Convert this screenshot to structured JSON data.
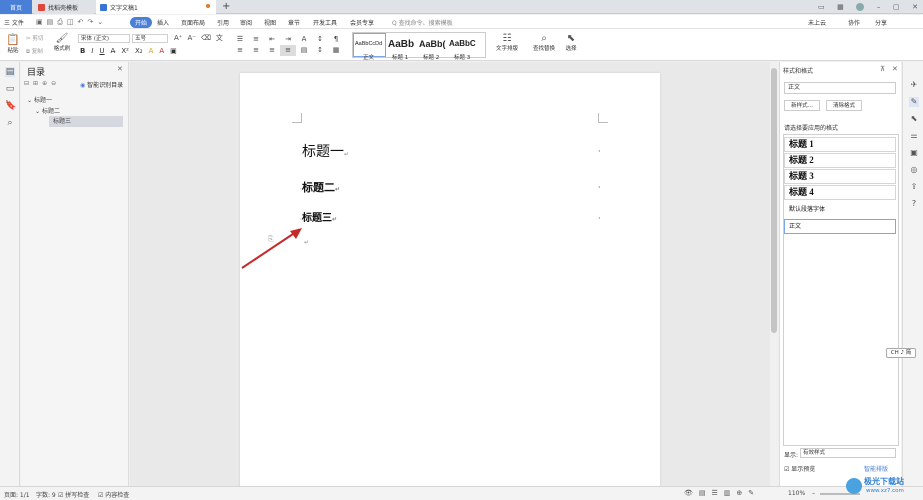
{
  "titlebar": {
    "tab_home": "首页",
    "tab_doc": "找稻壳模板",
    "tab_active": "文字文稿1",
    "new_tab": "+"
  },
  "menubar": {
    "file": "三 文件",
    "items": [
      "开始",
      "插入",
      "页面布局",
      "引用",
      "审阅",
      "视图",
      "章节",
      "开发工具",
      "会员专享"
    ],
    "search_placeholder": "Q 查找命令、搜索模板",
    "cloud": "未上云",
    "collab": "协作",
    "share": "分享"
  },
  "ribbon": {
    "paste": "粘贴",
    "cut": "剪切",
    "copy": "复制",
    "format_painter": "格式刷",
    "font_name": "宋体 (正文)",
    "font_size": "五号",
    "styles": [
      {
        "sample": "AaBbCcDd",
        "label": "正文"
      },
      {
        "sample": "AaBb",
        "label": "标题 1"
      },
      {
        "sample": "AaBb(",
        "label": "标题 2"
      },
      {
        "sample": "AaBbC",
        "label": "标题 3"
      }
    ],
    "text_layout": "文字排版",
    "find_replace": "查找替换",
    "select": "选择"
  },
  "toc": {
    "title": "目录",
    "smart_toc": "智能识别目录",
    "items": [
      "标题一",
      "标题二",
      "标题三"
    ]
  },
  "document": {
    "headings": [
      "标题一",
      "标题二",
      "标题三"
    ]
  },
  "right_panel": {
    "title": "样式和格式",
    "current_style": "正文",
    "new_style": "新样式...",
    "clear_format": "清除格式",
    "apply_label": "请选择要应用的格式",
    "styles": [
      "标题 1",
      "标题 2",
      "标题 3",
      "标题 4"
    ],
    "default_font": "默认段落字体",
    "body_style": "正文",
    "show_label": "显示:",
    "show_value": "有效样式",
    "show_preview": "显示预览",
    "smart_layout": "智能排版",
    "ime": "CH ♪ 简"
  },
  "status": {
    "page": "页面: 1/1",
    "words": "字数: 9",
    "spell": "拼写检查",
    "content_check": "内容检查",
    "zoom": "110%"
  },
  "watermark": {
    "text": "极光下载站",
    "url": "www.xz7.com"
  },
  "colors": {
    "accent": "#4a7fd8",
    "arrow": "#c62828"
  }
}
